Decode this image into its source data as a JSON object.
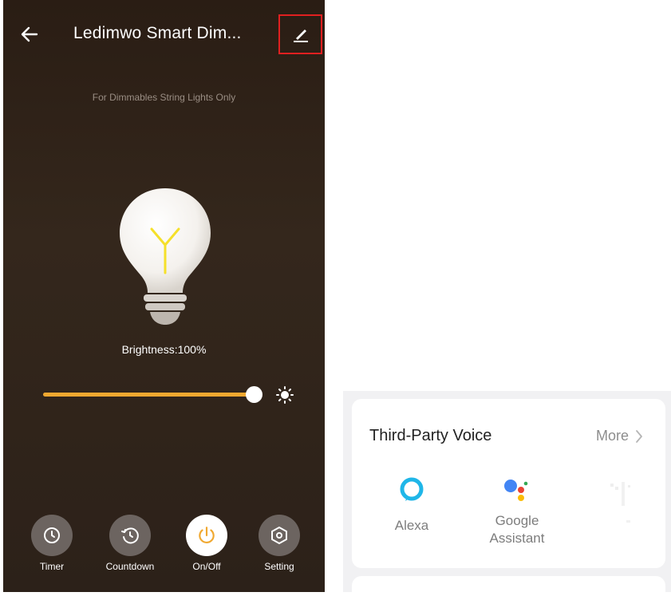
{
  "device": {
    "title": "Ledimwo Smart Dim...",
    "subtitle": "For Dimmables String Lights Only",
    "brightness_label": "Brightness:100%",
    "brightness_value": 1.0,
    "accent_color": "#f0a830",
    "icons": {
      "back": "back-arrow-icon",
      "edit": "pencil-edit-icon",
      "bulb": "lightbulb-icon",
      "sun": "sun-brightness-icon"
    },
    "controls": [
      {
        "label": "Timer",
        "icon": "clock-icon"
      },
      {
        "label": "Countdown",
        "icon": "countdown-icon"
      },
      {
        "label": "On/Off",
        "icon": "power-icon"
      },
      {
        "label": "Setting",
        "icon": "hexagon-gear-icon"
      }
    ]
  },
  "voice": {
    "title": "Third-Party Voice",
    "more_label": "More",
    "assistants": [
      {
        "label": "Alexa",
        "icon": "alexa-ring-icon"
      },
      {
        "label_line1": "Google",
        "label_line2": "Assistant",
        "icon": "google-assistant-icon"
      }
    ]
  }
}
